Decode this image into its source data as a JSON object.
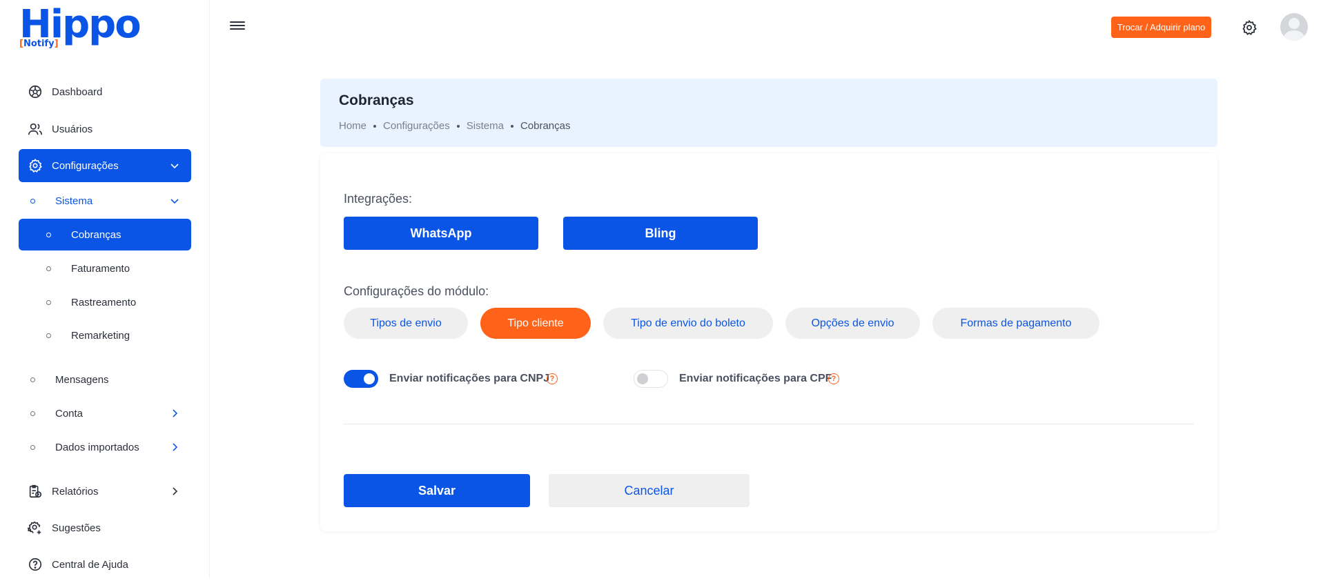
{
  "brand": {
    "name": "Hippo",
    "sub": "Notify",
    "color": "#0a55e6",
    "accent": "#ff6319"
  },
  "sidebar": {
    "items": [
      {
        "label": "Dashboard",
        "icon": "dashboard-icon"
      },
      {
        "label": "Usuários",
        "icon": "users-icon"
      },
      {
        "label": "Configurações",
        "icon": "gear-icon",
        "active": true,
        "expanded": true
      }
    ],
    "sistema": {
      "label": "Sistema",
      "children": [
        "Cobranças",
        "Faturamento",
        "Rastreamento",
        "Remarketing"
      ],
      "active_child": "Cobranças"
    },
    "config_children": [
      "Mensagens",
      "Conta",
      "Dados importados"
    ],
    "bottom_items": [
      {
        "label": "Relatórios",
        "icon": "report-icon"
      },
      {
        "label": "Sugestões",
        "icon": "settings-plus-icon"
      },
      {
        "label": "Central de Ajuda",
        "icon": "help-icon"
      }
    ]
  },
  "topbar": {
    "plan_button": "Trocar / Adquirir plano"
  },
  "header": {
    "title": "Cobranças",
    "breadcrumb": [
      "Home",
      "Configurações",
      "Sistema",
      "Cobranças"
    ]
  },
  "main": {
    "integrations_label": "Integrações:",
    "integrations": [
      "WhatsApp",
      "Bling"
    ],
    "module_label": "Configurações do módulo:",
    "module_tabs": [
      "Tipos de envio",
      "Tipo cliente",
      "Tipo de envio do boleto",
      "Opções de envio",
      "Formas de pagamento"
    ],
    "active_tab": "Tipo cliente",
    "toggles": [
      {
        "label": "Enviar notificações para CNPJ",
        "on": true
      },
      {
        "label": "Enviar notificações para CPF",
        "on": false
      }
    ],
    "help_glyph": "?",
    "save": "Salvar",
    "cancel": "Cancelar"
  }
}
